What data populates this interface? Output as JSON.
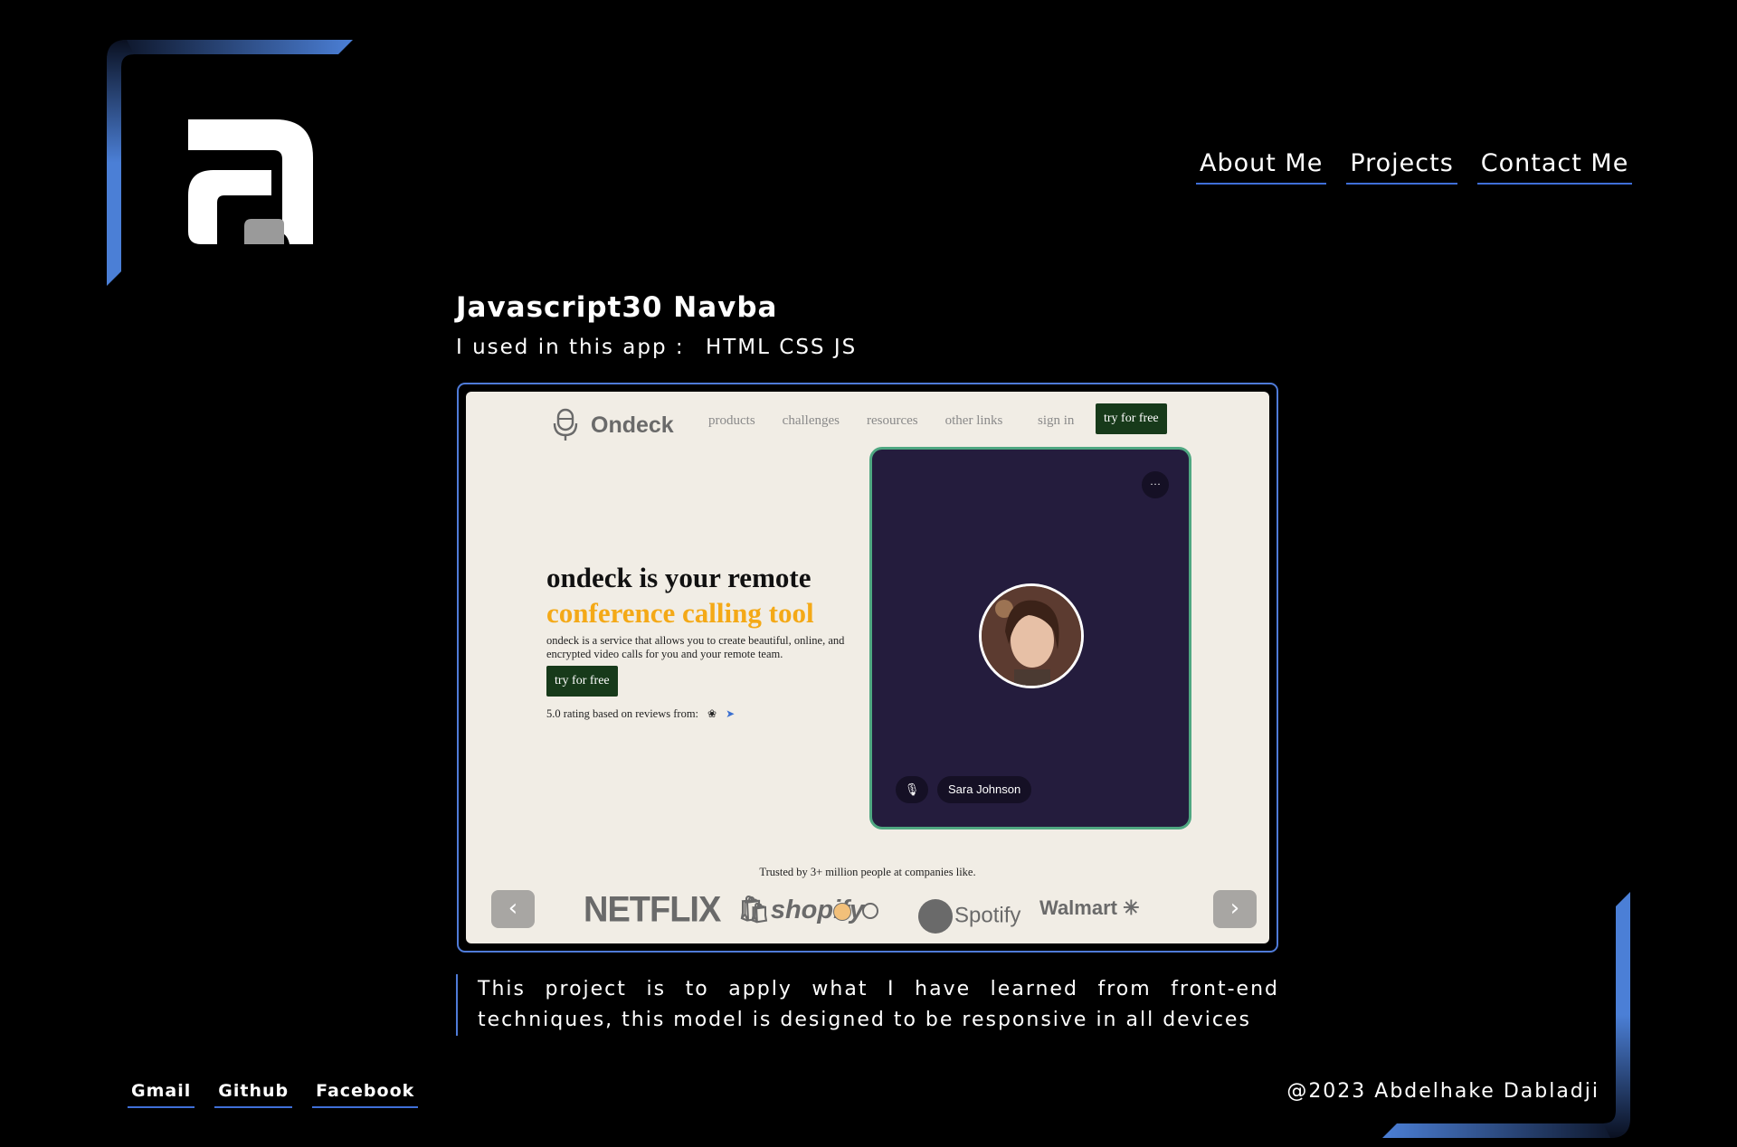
{
  "brand": {
    "accent": "#3f6fd8",
    "logo": "a-monogram-logo"
  },
  "nav": {
    "items": [
      {
        "label": "About Me"
      },
      {
        "label": "Projects"
      },
      {
        "label": "Contact Me"
      }
    ]
  },
  "project": {
    "title": "Javascript30 Navba",
    "tech_label": "I used in this app :",
    "tech_list": "HTML CSS JS",
    "description": "This project is to apply what I have learned from front-end techniques, this model is designed to be responsive in all devices"
  },
  "preview": {
    "site_name": "Ondeck",
    "nav_links": [
      "products",
      "challenges",
      "resources",
      "other links"
    ],
    "signin": "sign in",
    "cta_top": "try for free",
    "headline_1": "ondeck is your remote",
    "headline_2": "conference calling tool",
    "subtext": "ondeck is a service that allows you to create beautiful, online, and encrypted video calls for you and your remote team.",
    "cta": "try for free",
    "rating": "5.0 rating based on reviews from:",
    "menu_dots": "···",
    "person_name": "Sara Johnson",
    "trusted": "Trusted by 3+ million people at companies like.",
    "prev_arrow": "‹",
    "next_arrow": "›",
    "brands": [
      "NETFLIX",
      "shopify",
      "Spotify",
      "Walmart"
    ]
  },
  "footer": {
    "links": [
      "Gmail",
      "Github",
      "Facebook"
    ],
    "copyright": "@2023 Abdelhake Dabladji"
  }
}
